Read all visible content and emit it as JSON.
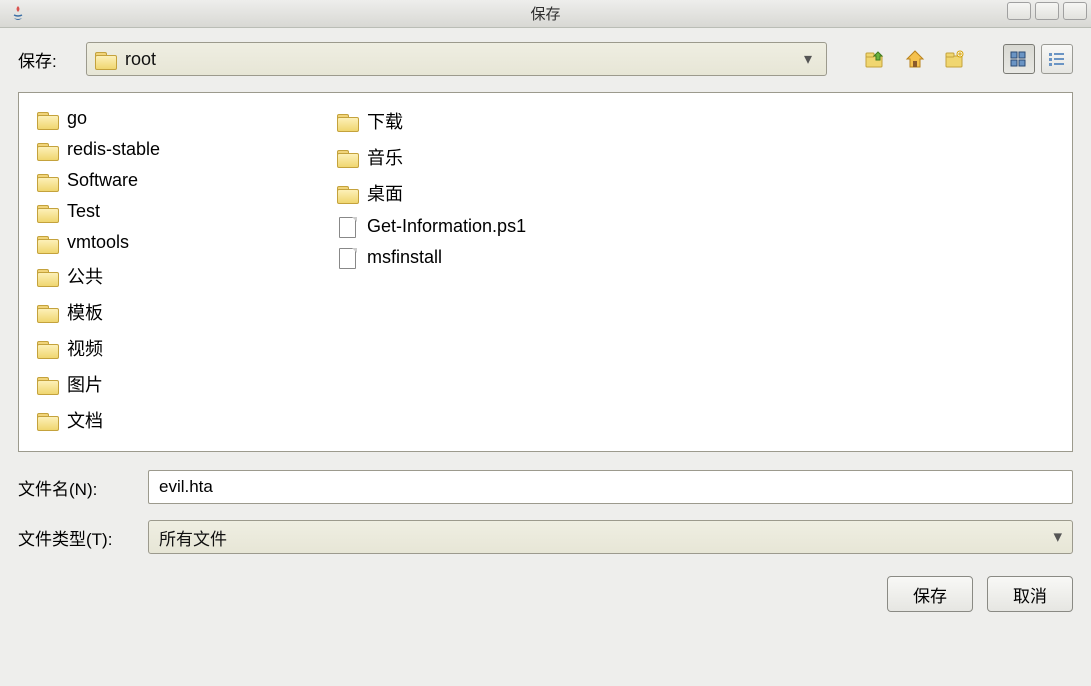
{
  "window": {
    "title": "保存"
  },
  "toolbar": {
    "save_in_label": "保存:",
    "current_location": "root"
  },
  "files": {
    "column1": [
      {
        "name": "go",
        "type": "folder"
      },
      {
        "name": "redis-stable",
        "type": "folder"
      },
      {
        "name": "Software",
        "type": "folder"
      },
      {
        "name": "Test",
        "type": "folder"
      },
      {
        "name": "vmtools",
        "type": "folder"
      },
      {
        "name": "公共",
        "type": "folder"
      },
      {
        "name": "模板",
        "type": "folder"
      },
      {
        "name": "视频",
        "type": "folder"
      },
      {
        "name": "图片",
        "type": "folder"
      }
    ],
    "column2": [
      {
        "name": "文档",
        "type": "folder"
      },
      {
        "name": "下载",
        "type": "folder"
      },
      {
        "name": "音乐",
        "type": "folder"
      },
      {
        "name": "桌面",
        "type": "folder"
      },
      {
        "name": "Get-Information.ps1",
        "type": "file"
      },
      {
        "name": "msfinstall",
        "type": "file"
      }
    ]
  },
  "form": {
    "filename_label": "文件名(N):",
    "filename_value": "evil.hta",
    "filetype_label": "文件类型(T):",
    "filetype_value": "所有文件"
  },
  "buttons": {
    "save": "保存",
    "cancel": "取消"
  }
}
